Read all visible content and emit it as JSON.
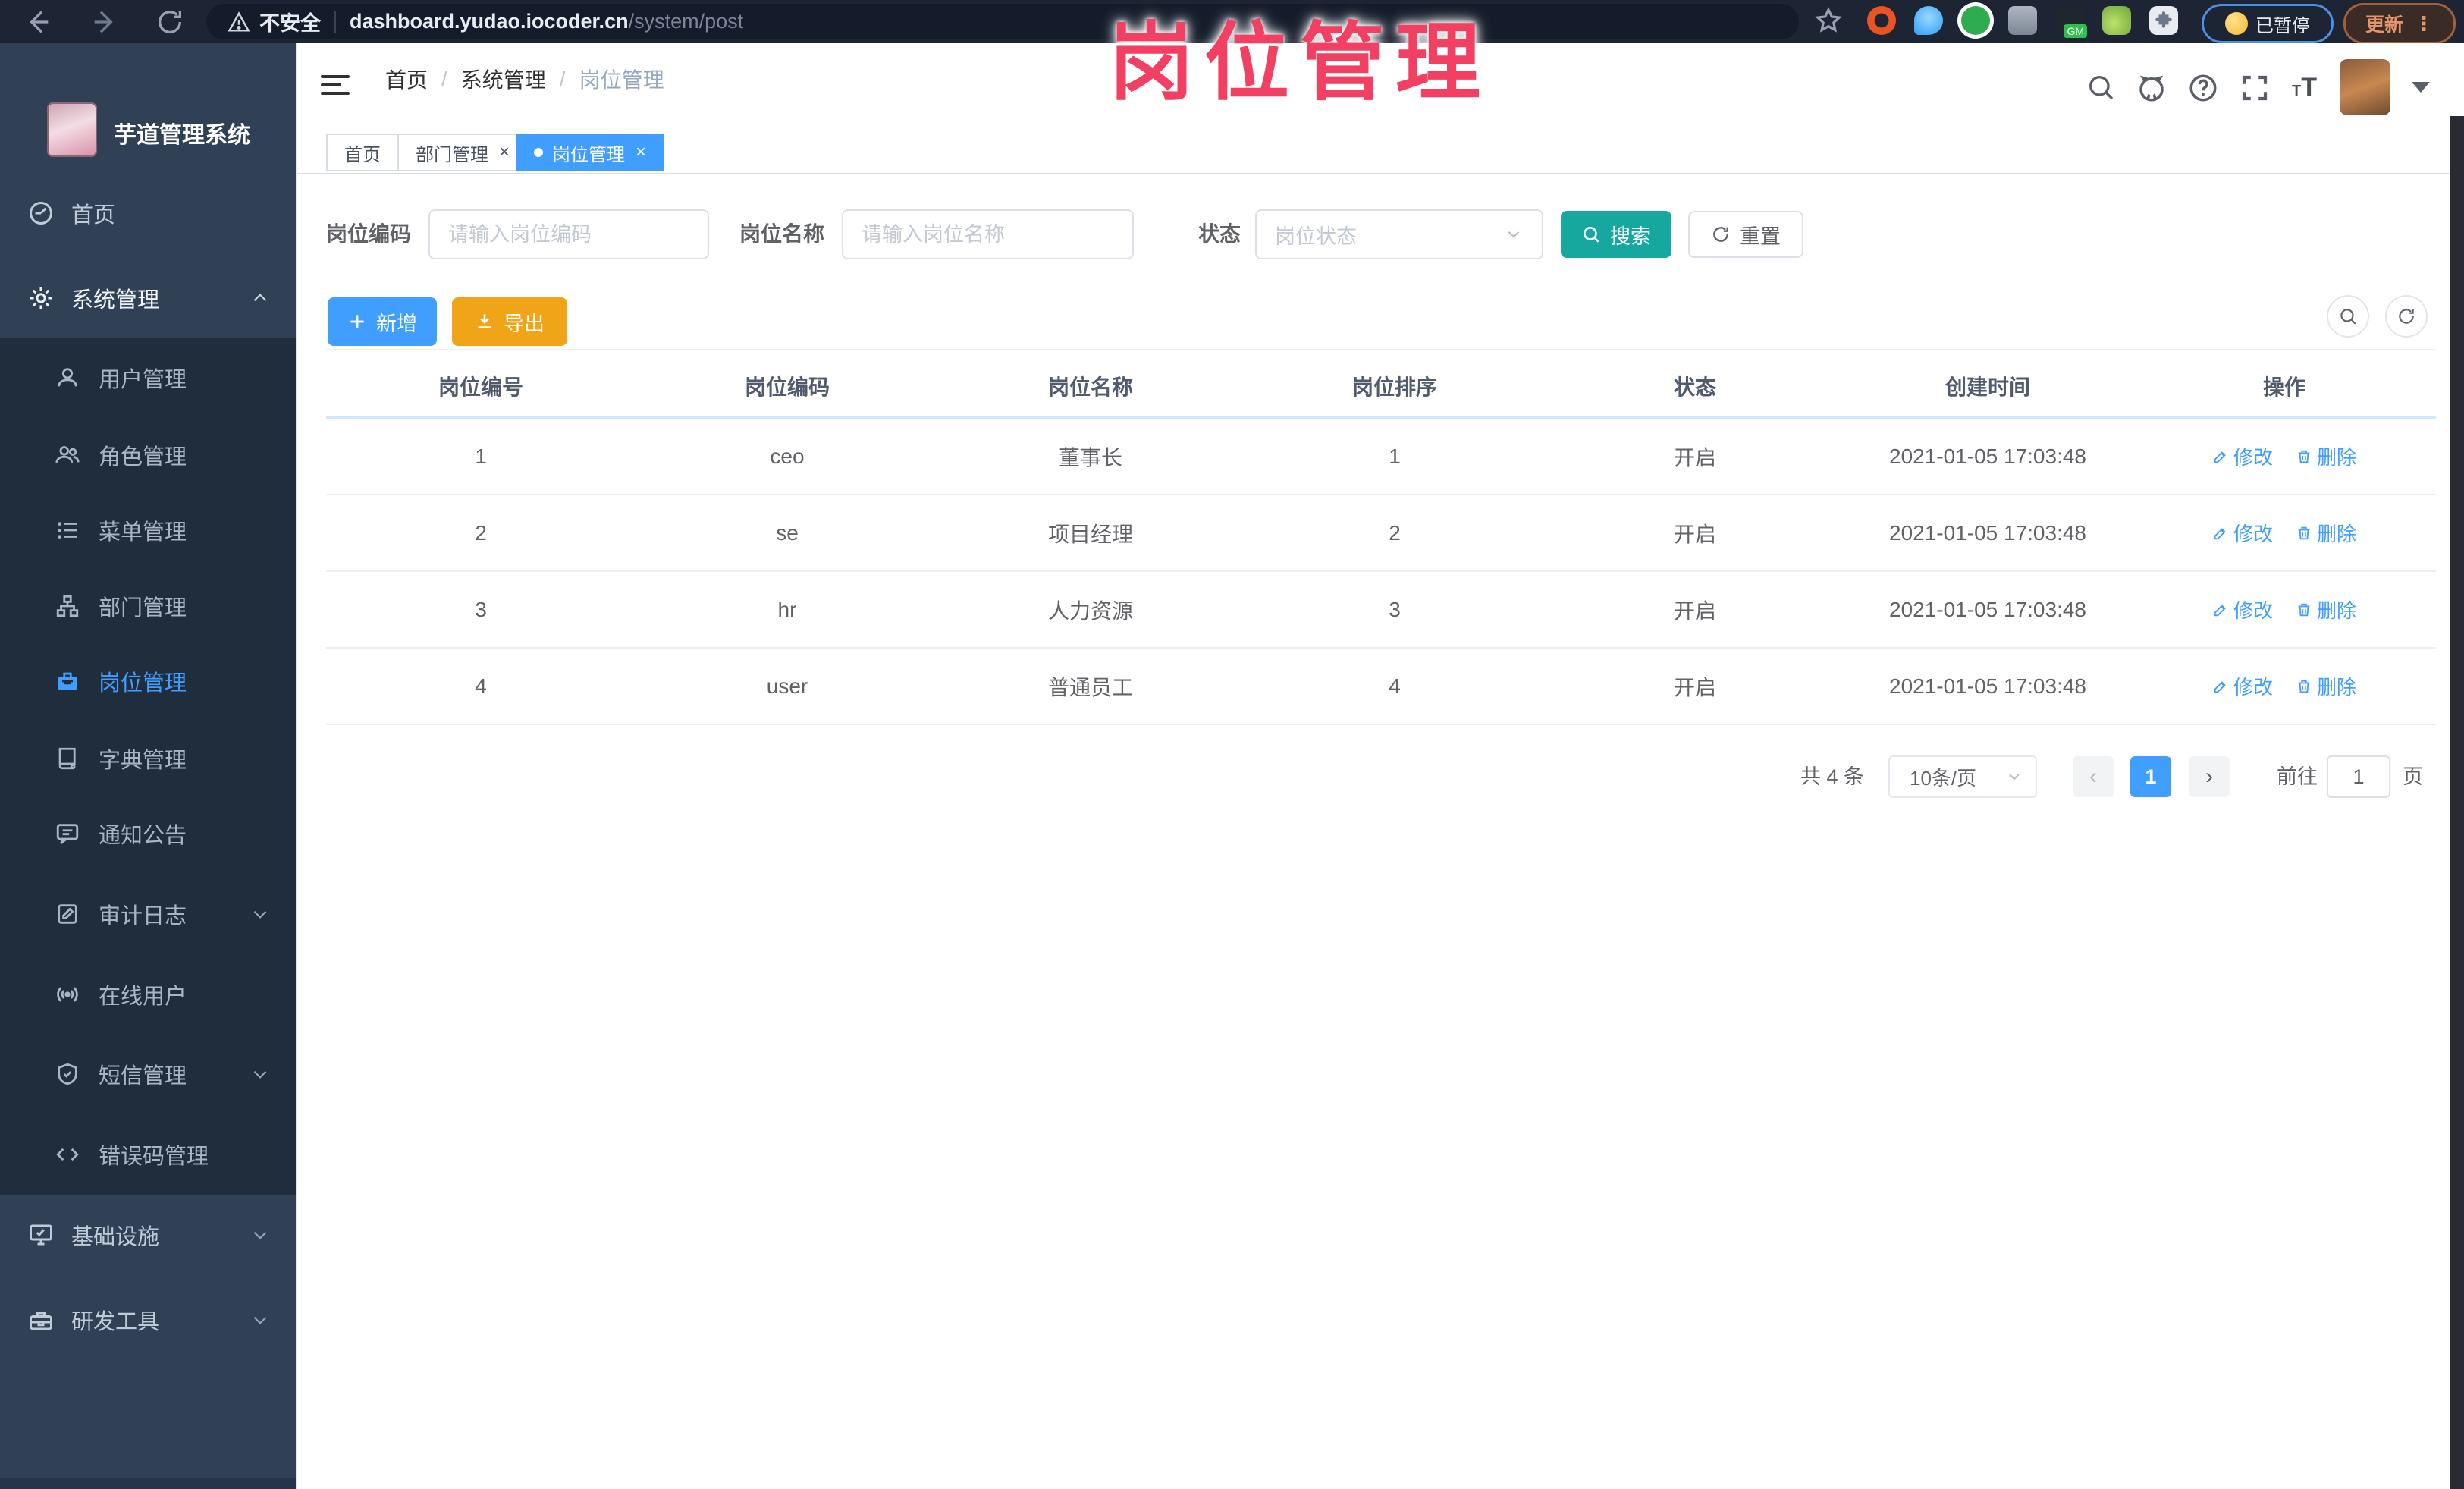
{
  "colors": {
    "primary": "#409eff",
    "teal": "#16a89e",
    "warning": "#f0a418",
    "sidebar_bg": "#304156",
    "submenu_bg": "#1f2d3d",
    "watermark_pink": "#f23f62",
    "active_tab": "#409eff"
  },
  "browser": {
    "security_label": "不安全",
    "url_host": "dashboard.yudao.iocoder.cn",
    "url_path": "/system/post",
    "paused_label": "已暂停",
    "update_label": "更新"
  },
  "watermark": "岗位管理",
  "sidebar": {
    "app_title": "芋道管理系统",
    "items": [
      {
        "label": "首页"
      },
      {
        "label": "系统管理"
      },
      {
        "label": "基础设施"
      },
      {
        "label": "研发工具"
      }
    ],
    "system_children": [
      {
        "label": "用户管理"
      },
      {
        "label": "角色管理"
      },
      {
        "label": "菜单管理"
      },
      {
        "label": "部门管理"
      },
      {
        "label": "岗位管理"
      },
      {
        "label": "字典管理"
      },
      {
        "label": "通知公告"
      },
      {
        "label": "审计日志"
      },
      {
        "label": "在线用户"
      },
      {
        "label": "短信管理"
      },
      {
        "label": "错误码管理"
      }
    ]
  },
  "breadcrumb": {
    "home": "首页",
    "section": "系统管理",
    "current": "岗位管理"
  },
  "tabs": [
    {
      "label": "首页"
    },
    {
      "label": "部门管理"
    },
    {
      "label": "岗位管理"
    }
  ],
  "filters": {
    "post_code_label": "岗位编码",
    "post_code_placeholder": "请输入岗位编码",
    "post_name_label": "岗位名称",
    "post_name_placeholder": "请输入岗位名称",
    "status_label": "状态",
    "status_placeholder": "岗位状态",
    "search_label": "搜索",
    "reset_label": "重置"
  },
  "toolbar": {
    "add_label": "新增",
    "export_label": "导出"
  },
  "table": {
    "headers": [
      "岗位编号",
      "岗位编码",
      "岗位名称",
      "岗位排序",
      "状态",
      "创建时间",
      "操作"
    ],
    "edit_label": "修改",
    "delete_label": "删除",
    "rows": [
      {
        "id": "1",
        "code": "ceo",
        "name": "董事长",
        "sort": "1",
        "status": "开启",
        "created": "2021-01-05 17:03:48"
      },
      {
        "id": "2",
        "code": "se",
        "name": "项目经理",
        "sort": "2",
        "status": "开启",
        "created": "2021-01-05 17:03:48"
      },
      {
        "id": "3",
        "code": "hr",
        "name": "人力资源",
        "sort": "3",
        "status": "开启",
        "created": "2021-01-05 17:03:48"
      },
      {
        "id": "4",
        "code": "user",
        "name": "普通员工",
        "sort": "4",
        "status": "开启",
        "created": "2021-01-05 17:03:48"
      }
    ]
  },
  "pagination": {
    "total_text": "共 4 条",
    "page_size": "10条/页",
    "prev_glyph": "‹",
    "next_glyph": "›",
    "current_page": "1",
    "goto_label": "前往",
    "goto_value": "1",
    "page_suffix": "页"
  }
}
